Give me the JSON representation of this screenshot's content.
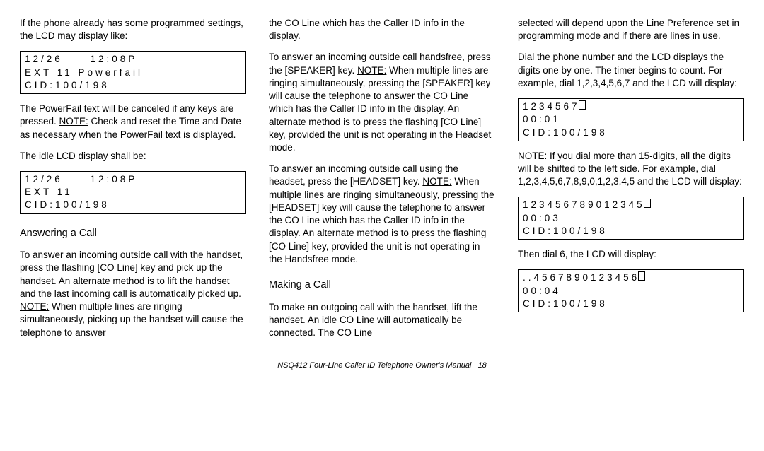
{
  "col1": {
    "p1": "If the phone already has some pro­grammed settings, the LCD may display like:",
    "lcd1_line1": "12/26     12:08P",
    "lcd1_line2": "EXT 11 Powerfail",
    "lcd1_line3": "CID:100/198",
    "p2a": "The  PowerFail  text will be canceled if any keys are pressed. ",
    "p2_note": "NOTE:",
    "p2b": " Check and reset the Time and Date as necessary when the  PowerFail  text is displayed.",
    "p3": "The idle LCD display shall be:",
    "lcd2_line1": "12/26     12:08P",
    "lcd2_line2": "EXT 11",
    "lcd2_line3": "CID:100/198",
    "h1": "Answering a Call",
    "p4a": "To answer an incoming outside call with the handset, press the flashing [CO Line] key and pick up the handset. An alter­nate method is to lift the handset and the last incoming call is automatically picked up. ",
    "p4_note": "NOTE:",
    "p4b": " When multiple lines are ring­ing simultaneously, picking up the hand­set will cause the telephone to answer"
  },
  "col2": {
    "p1": "the CO Line which has the Caller ID info in the display.",
    "p2a": "To answer an incoming outside call handsfree, press the [SPEAKER] key. ",
    "p2_note": "NOTE:",
    "p2b": " When multiple lines are ringing simultaneously, pressing the [SPEAKER] key will cause the telephone to answer the CO Line which has the Caller ID info in the display. An alternate method is to press the flashing [CO Line] key, provid­ed the unit is not operating in the Headset mode.",
    "p3a": "To answer an incoming outside call using the headset, press the [HEADSET] key. ",
    "p3_note": "NOTE:",
    "p3b": " When multiple lines are ringing simultaneously, pressing the [HEADSET] key will cause the telephone to answer the CO Line which has the Caller ID info in the display. An alternate method is to press the flashing [CO Line] key, provid­ed the unit is not operating in the Handsfree mode.",
    "h1": "Making a Call",
    "p4": "To make an outgoing call with the hand­set, lift the handset. An idle CO Line will automatically be connected. The CO Line"
  },
  "col3": {
    "p1": "selected will depend upon the Line Preference set in programming mode and if there are lines in use.",
    "p2": "Dial the phone number and the LCD dis­plays the digits one by one. The timer begins to count. For example, dial 1,2,3,4,5,6,7 and the LCD will display:",
    "lcd1_line1": "1234567",
    "lcd1_line2": "00:01",
    "lcd1_line3": "CID:100/198",
    "p3a_note": "NOTE:",
    "p3a": " If you dial more than 15-digits, all the digits will be shifted to the left side. For example, dial 1,2,3,4,5,6,7,8,9,0,1,2,3,4,5 and the LCD will display:",
    "lcd2_line1": "123456789012345",
    "lcd2_line2": "00:03",
    "lcd2_line3": "CID:100/198",
    "p4": "Then dial 6, the LCD will display:",
    "lcd3_line1": "..4567890123456",
    "lcd3_line2": "00:04",
    "lcd3_line3": "CID:100/198"
  },
  "footer": {
    "title": "NSQ412 Four-Line Caller ID Telephone Owner's Manual",
    "page": "18"
  }
}
